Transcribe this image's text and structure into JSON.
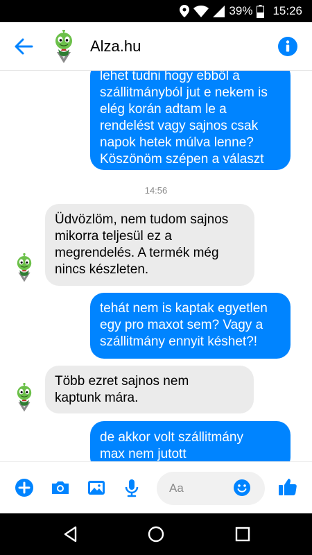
{
  "status_bar": {
    "battery": "39%",
    "time": "15:26"
  },
  "header": {
    "title": "Alza.hu"
  },
  "messages": [
    {
      "direction": "outgoing",
      "lines": [
        "lehet tudni hogy ebből a",
        "szállitmányból jut e nekem is",
        "elég korán adtam le a",
        "rendelést vagy sajnos csak",
        "napok hetek múlva lenne?",
        "Köszönöm szépen a választ"
      ]
    },
    {
      "direction": "incoming",
      "lines": [
        "Üdvözlöm, nem tudom sajnos",
        "mikorra teljesül ez a",
        "megrendelés. A termék még",
        "nincs készleten."
      ]
    },
    {
      "direction": "outgoing",
      "lines": [
        "tehát nem is kaptak egyetlen",
        "egy pro maxot sem? Vagy a",
        "szállitmány ennyit késhet?!"
      ]
    },
    {
      "direction": "incoming",
      "lines": [
        "Több ezret sajnos nem",
        "kaptunk mára."
      ]
    },
    {
      "direction": "outgoing",
      "lines": [
        "de akkor volt szállitmány",
        "max nem jutott"
      ]
    }
  ],
  "timestamp": "14:56",
  "composer": {
    "placeholder": "Aa"
  },
  "colors": {
    "accent": "#0084ff",
    "incoming_bubble": "#ebebeb",
    "timestamp": "#8a8a8a"
  },
  "icons": {
    "back": "arrow-left-icon",
    "info": "info-icon",
    "add": "plus-circle-icon",
    "camera": "camera-icon",
    "gallery": "image-icon",
    "mic": "microphone-icon",
    "emoji": "smiley-icon",
    "like": "thumbs-up-icon",
    "nav_back": "triangle-back-icon",
    "nav_home": "circle-home-icon",
    "nav_recents": "square-recents-icon"
  }
}
